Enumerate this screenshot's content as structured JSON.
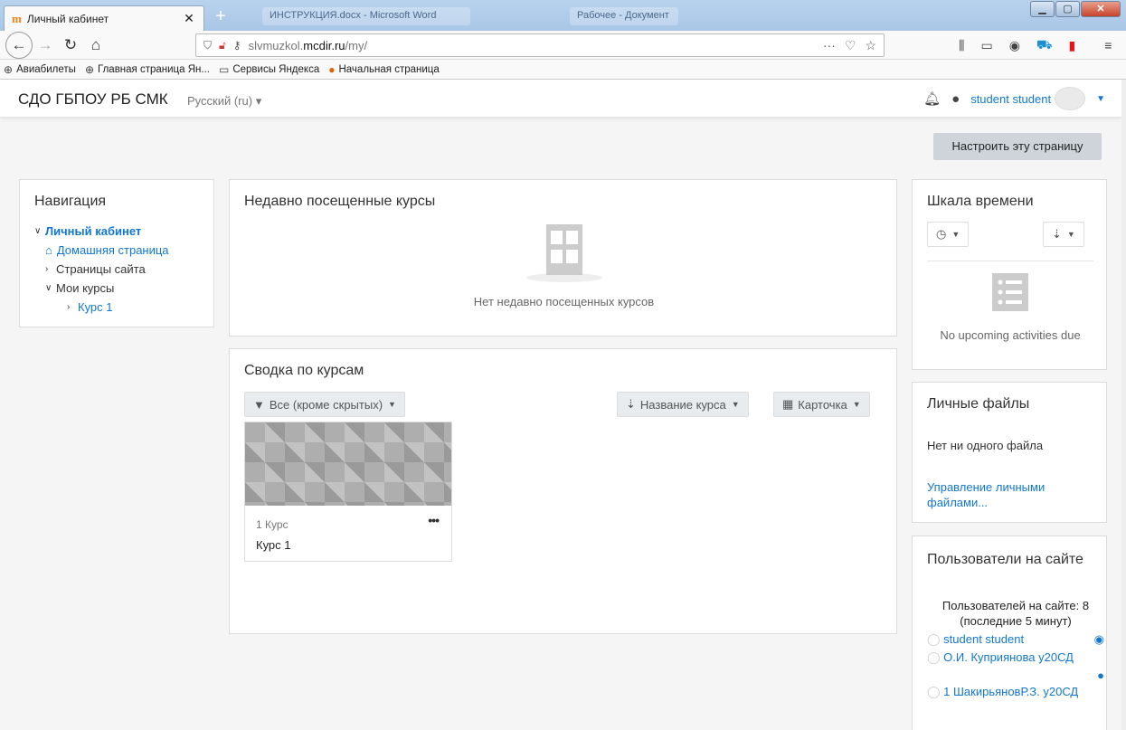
{
  "browser": {
    "tab_title": "Личный кабинет",
    "tab_favicon": "m",
    "bg_tab_1": "ИНСТРУКЦИЯ.docx - Microsoft Word",
    "bg_tab_2": "Рабочее - Документ",
    "url_prefix": "slvmuzkol.",
    "url_domain": "mcdir.ru",
    "url_path": "/my/",
    "bookmarks": [
      "Авиабилеты",
      "Главная страница Ян...",
      "Сервисы Яндекса",
      "Начальная страница"
    ]
  },
  "header": {
    "site_name": "СДО ГБПОУ РБ СМК",
    "language": "Русский (ru)",
    "user_name": "student student"
  },
  "page": {
    "customize_button": "Настроить эту страницу"
  },
  "navigation": {
    "title": "Навигация",
    "items": [
      {
        "label": "Личный кабинет"
      },
      {
        "label": "Домашняя страница"
      },
      {
        "label": "Страницы сайта"
      },
      {
        "label": "Мои курсы"
      },
      {
        "label": "Курс 1"
      }
    ]
  },
  "recent": {
    "title": "Недавно посещенные курсы",
    "empty_text": "Нет недавно посещенных курсов"
  },
  "overview": {
    "title": "Сводка по курсам",
    "filter": "Все (кроме скрытых)",
    "sort": "Название курса",
    "view": "Карточка",
    "course": {
      "category": "1 Курс",
      "name": "Курс 1"
    }
  },
  "timeline": {
    "title": "Шкала времени",
    "empty_text": "No upcoming activities due"
  },
  "files": {
    "title": "Личные файлы",
    "empty_text": "Нет ни одного файла",
    "manage_link": "Управление личными файлами..."
  },
  "online": {
    "title": "Пользователи на сайте",
    "summary": "Пользователей на сайте: 8 (последние 5 минут)",
    "users": [
      "student student",
      "О.И. Куприянова у20СД",
      "1 ШакирьяновР.З. у20СД"
    ]
  }
}
